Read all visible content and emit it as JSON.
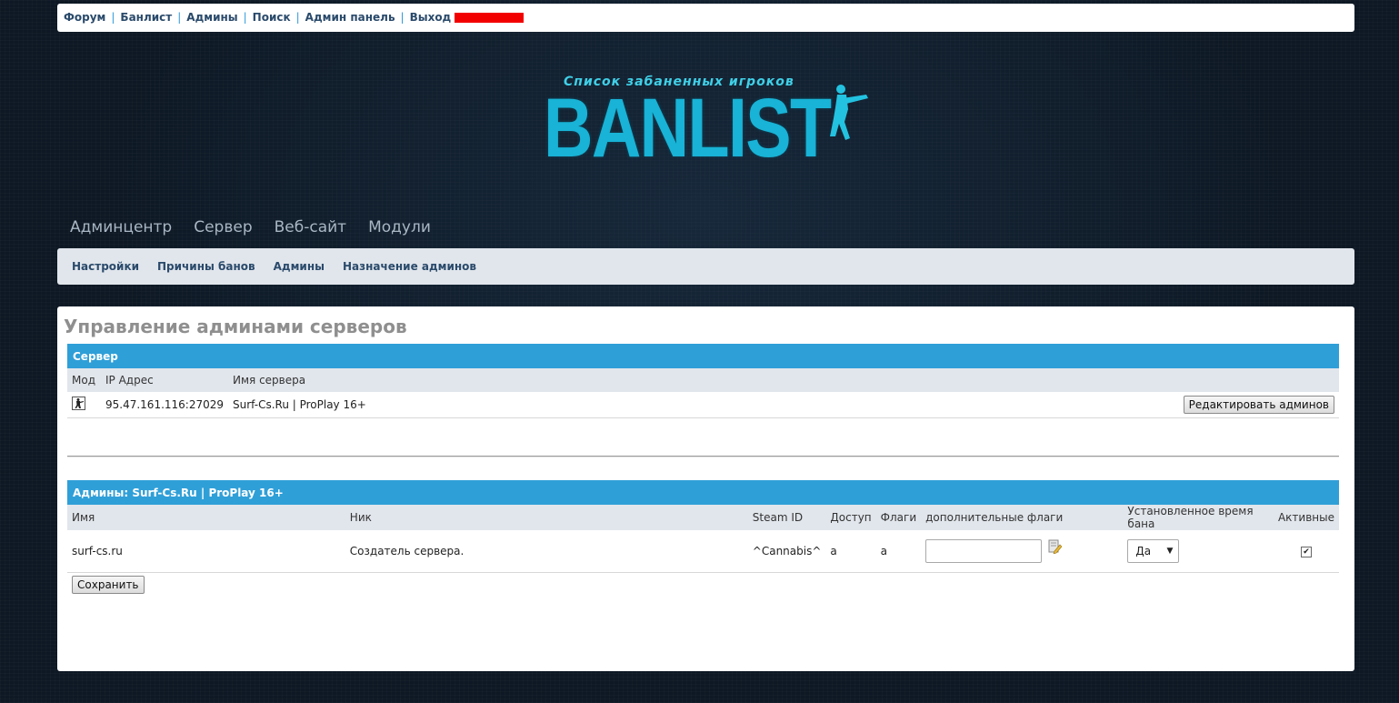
{
  "topnav": {
    "items": [
      "Форум",
      "Банлист",
      "Админы",
      "Поиск",
      "Админ панель",
      "Выход"
    ],
    "separator": "|"
  },
  "logo": {
    "subtitle": "Список забаненных игроков",
    "title": "BANLIST"
  },
  "mainnav": {
    "items": [
      "Админцентр",
      "Сервер",
      "Веб-сайт",
      "Модули"
    ]
  },
  "subnav": {
    "items": [
      "Настройки",
      "Причины банов",
      "Админы",
      "Назначение админов"
    ]
  },
  "page": {
    "title": "Управление админами серверов"
  },
  "server_table": {
    "header": "Сервер",
    "columns": [
      "Мод",
      "IP Адрес",
      "Имя сервера"
    ],
    "rows": [
      {
        "ip": "95.47.161.116:27029",
        "name": "Surf-Cs.Ru | ProPlay 16+",
        "action": "Редактировать админов"
      }
    ]
  },
  "admins_table": {
    "header": "Админы: Surf-Cs.Ru  |  ProPlay 16+",
    "columns": [
      "Имя",
      "Ник",
      "Steam ID",
      "Доступ",
      "Флаги",
      "дополнительные флаги",
      "Установленное время бана",
      "Активные"
    ],
    "rows": [
      {
        "name": "surf-cs.ru",
        "nick": "Создатель сервера.",
        "steam_id": "^Cannabis^",
        "access": "a",
        "flags": "a",
        "extra_flags": "",
        "ban_time": "Да",
        "active": true
      }
    ],
    "save_label": "Сохранить"
  },
  "colors": {
    "accent": "#2f9fd8",
    "link": "#2a4a6b",
    "redaction": "#f20000"
  }
}
